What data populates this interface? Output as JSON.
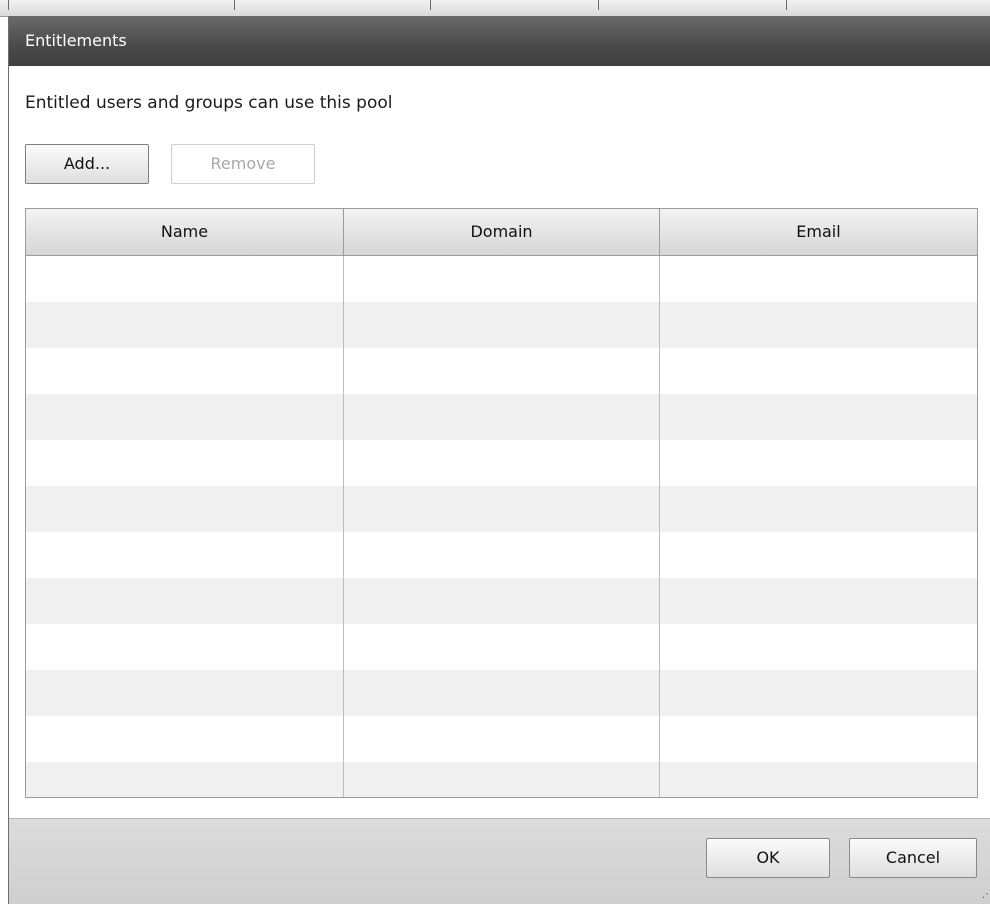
{
  "dialog": {
    "title": "Entitlements",
    "description": "Entitled users and groups can use this pool",
    "buttons": {
      "add": "Add...",
      "remove": "Remove",
      "ok": "OK",
      "cancel": "Cancel"
    },
    "table": {
      "columns": [
        "Name",
        "Domain",
        "Email"
      ],
      "rows": []
    }
  }
}
